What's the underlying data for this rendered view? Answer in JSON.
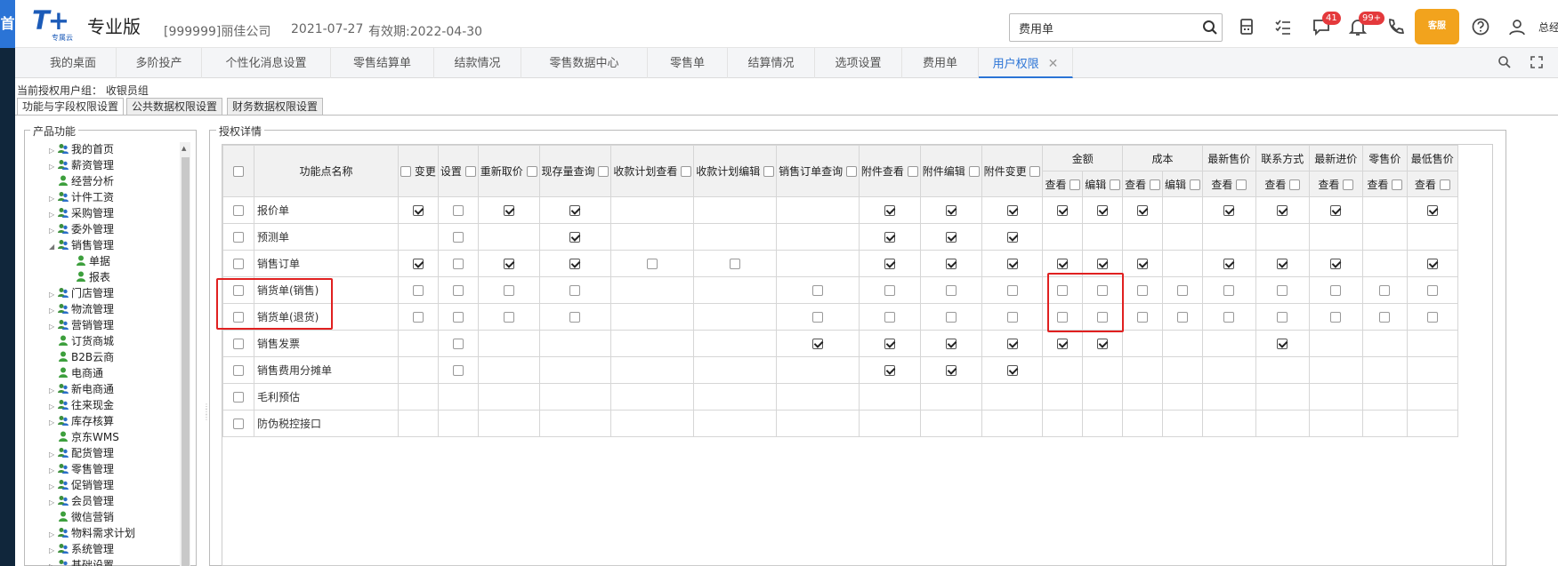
{
  "header": {
    "blue_strip_text": "首",
    "logo_mark": "T+",
    "logo_sub": "专属云",
    "edition": "专业版",
    "company": "[999999]丽佳公司",
    "date": "2021-07-27",
    "validity": "有效期:2022-04-30",
    "search_value": "费用单",
    "badge_messages": "41",
    "badge_notifications": "99+",
    "mascot_text": "客服",
    "user_name": "总经"
  },
  "tabs": [
    {
      "label": "我的桌面"
    },
    {
      "label": "多阶投产"
    },
    {
      "label": "个性化消息设置"
    },
    {
      "label": "零售结算单"
    },
    {
      "label": "结款情况"
    },
    {
      "label": "零售数据中心"
    },
    {
      "label": "零售单"
    },
    {
      "label": "结算情况"
    },
    {
      "label": "选项设置"
    },
    {
      "label": "费用单"
    },
    {
      "label": "用户权限",
      "active": true,
      "close": "✕"
    }
  ],
  "group_label": "当前授权用户组： 收银员组",
  "subtabs": [
    "功能与字段权限设置",
    "公共数据权限设置",
    "财务数据权限设置"
  ],
  "tree_title": "产品功能",
  "tree": [
    {
      "label": "我的首页",
      "arrow": "▷",
      "indent": 0
    },
    {
      "label": "薪资管理",
      "arrow": "▷",
      "indent": 0
    },
    {
      "label": "经营分析",
      "arrow": "",
      "indent": 0
    },
    {
      "label": "计件工资",
      "arrow": "▷",
      "indent": 0
    },
    {
      "label": "采购管理",
      "arrow": "▷",
      "indent": 0
    },
    {
      "label": "委外管理",
      "arrow": "▷",
      "indent": 0
    },
    {
      "label": "销售管理",
      "arrow": "◢",
      "indent": 0
    },
    {
      "label": "单据",
      "arrow": "",
      "indent": 2
    },
    {
      "label": "报表",
      "arrow": "",
      "indent": 2
    },
    {
      "label": "门店管理",
      "arrow": "▷",
      "indent": 0
    },
    {
      "label": "物流管理",
      "arrow": "▷",
      "indent": 0
    },
    {
      "label": "营销管理",
      "arrow": "▷",
      "indent": 0
    },
    {
      "label": "订货商城",
      "arrow": "",
      "indent": 0
    },
    {
      "label": "B2B云商",
      "arrow": "",
      "indent": 0
    },
    {
      "label": "电商通",
      "arrow": "",
      "indent": 0
    },
    {
      "label": "新电商通",
      "arrow": "▷",
      "indent": 0
    },
    {
      "label": "往来现金",
      "arrow": "▷",
      "indent": 0
    },
    {
      "label": "库存核算",
      "arrow": "▷",
      "indent": 0
    },
    {
      "label": "京东WMS",
      "arrow": "",
      "indent": 0
    },
    {
      "label": "配货管理",
      "arrow": "▷",
      "indent": 0
    },
    {
      "label": "零售管理",
      "arrow": "▷",
      "indent": 0
    },
    {
      "label": "促销管理",
      "arrow": "▷",
      "indent": 0
    },
    {
      "label": "会员管理",
      "arrow": "▷",
      "indent": 0
    },
    {
      "label": "微信营销",
      "arrow": "",
      "indent": 0
    },
    {
      "label": "物料需求计划",
      "arrow": "▷",
      "indent": 0
    },
    {
      "label": "系统管理",
      "arrow": "▷",
      "indent": 0
    },
    {
      "label": "基础设置",
      "arrow": "▷",
      "indent": 0
    }
  ],
  "detail_title": "授权详情",
  "grid": {
    "name_header": "功能点名称",
    "simple_headers": [
      "变更",
      "设置",
      "重新取价",
      "现存量查询",
      "收款计划查看",
      "收款计划编辑",
      "销售订单查询",
      "附件查看",
      "附件编辑",
      "附件变更"
    ],
    "group_headers": [
      {
        "label": "金额",
        "subs": [
          "查看",
          "编辑"
        ]
      },
      {
        "label": "成本",
        "subs": [
          "查看",
          "编辑"
        ]
      },
      {
        "label": "最新售价",
        "subs": [
          "查看"
        ]
      },
      {
        "label": "联系方式",
        "subs": [
          "查看"
        ]
      },
      {
        "label": "最新进价",
        "subs": [
          "查看"
        ]
      },
      {
        "label": "零售价",
        "subs": [
          "查看"
        ]
      },
      {
        "label": "最低售价",
        "subs": [
          "查看"
        ]
      }
    ],
    "rows": [
      {
        "name": "报价单",
        "cells": [
          1,
          0,
          1,
          1,
          null,
          null,
          null,
          1,
          1,
          1,
          1,
          1,
          1,
          null,
          1,
          1,
          1,
          null,
          1
        ]
      },
      {
        "name": "预测单",
        "cells": [
          null,
          0,
          null,
          1,
          null,
          null,
          null,
          1,
          1,
          1,
          null,
          null,
          null,
          null,
          null,
          null,
          null,
          null,
          null
        ]
      },
      {
        "name": "销售订单",
        "cells": [
          1,
          0,
          1,
          1,
          0,
          0,
          null,
          1,
          1,
          1,
          1,
          1,
          1,
          null,
          1,
          1,
          1,
          null,
          1
        ]
      },
      {
        "name": "销货单(销售)",
        "cells": [
          0,
          0,
          0,
          0,
          null,
          null,
          0,
          0,
          0,
          0,
          0,
          0,
          0,
          0,
          0,
          0,
          0,
          0,
          0
        ]
      },
      {
        "name": "销货单(退货)",
        "cells": [
          0,
          0,
          0,
          0,
          null,
          null,
          0,
          0,
          0,
          0,
          0,
          0,
          0,
          0,
          0,
          0,
          0,
          0,
          0
        ]
      },
      {
        "name": "销售发票",
        "cells": [
          null,
          0,
          null,
          null,
          null,
          null,
          1,
          1,
          1,
          1,
          1,
          1,
          null,
          null,
          null,
          1,
          null,
          null,
          null
        ]
      },
      {
        "name": "销售费用分摊单",
        "cells": [
          null,
          0,
          null,
          null,
          null,
          null,
          null,
          1,
          1,
          1,
          null,
          null,
          null,
          null,
          null,
          null,
          null,
          null,
          null
        ]
      },
      {
        "name": "毛利预估",
        "cells": [
          null,
          null,
          null,
          null,
          null,
          null,
          null,
          null,
          null,
          null,
          null,
          null,
          null,
          null,
          null,
          null,
          null,
          null,
          null
        ]
      },
      {
        "name": "防伪税控接口",
        "cells": [
          null,
          null,
          null,
          null,
          null,
          null,
          null,
          null,
          null,
          null,
          null,
          null,
          null,
          null,
          null,
          null,
          null,
          null,
          null
        ]
      }
    ]
  },
  "colors": {
    "accent": "#2b74d6",
    "highlight": "#e02020",
    "sidebar": "#10263b"
  }
}
